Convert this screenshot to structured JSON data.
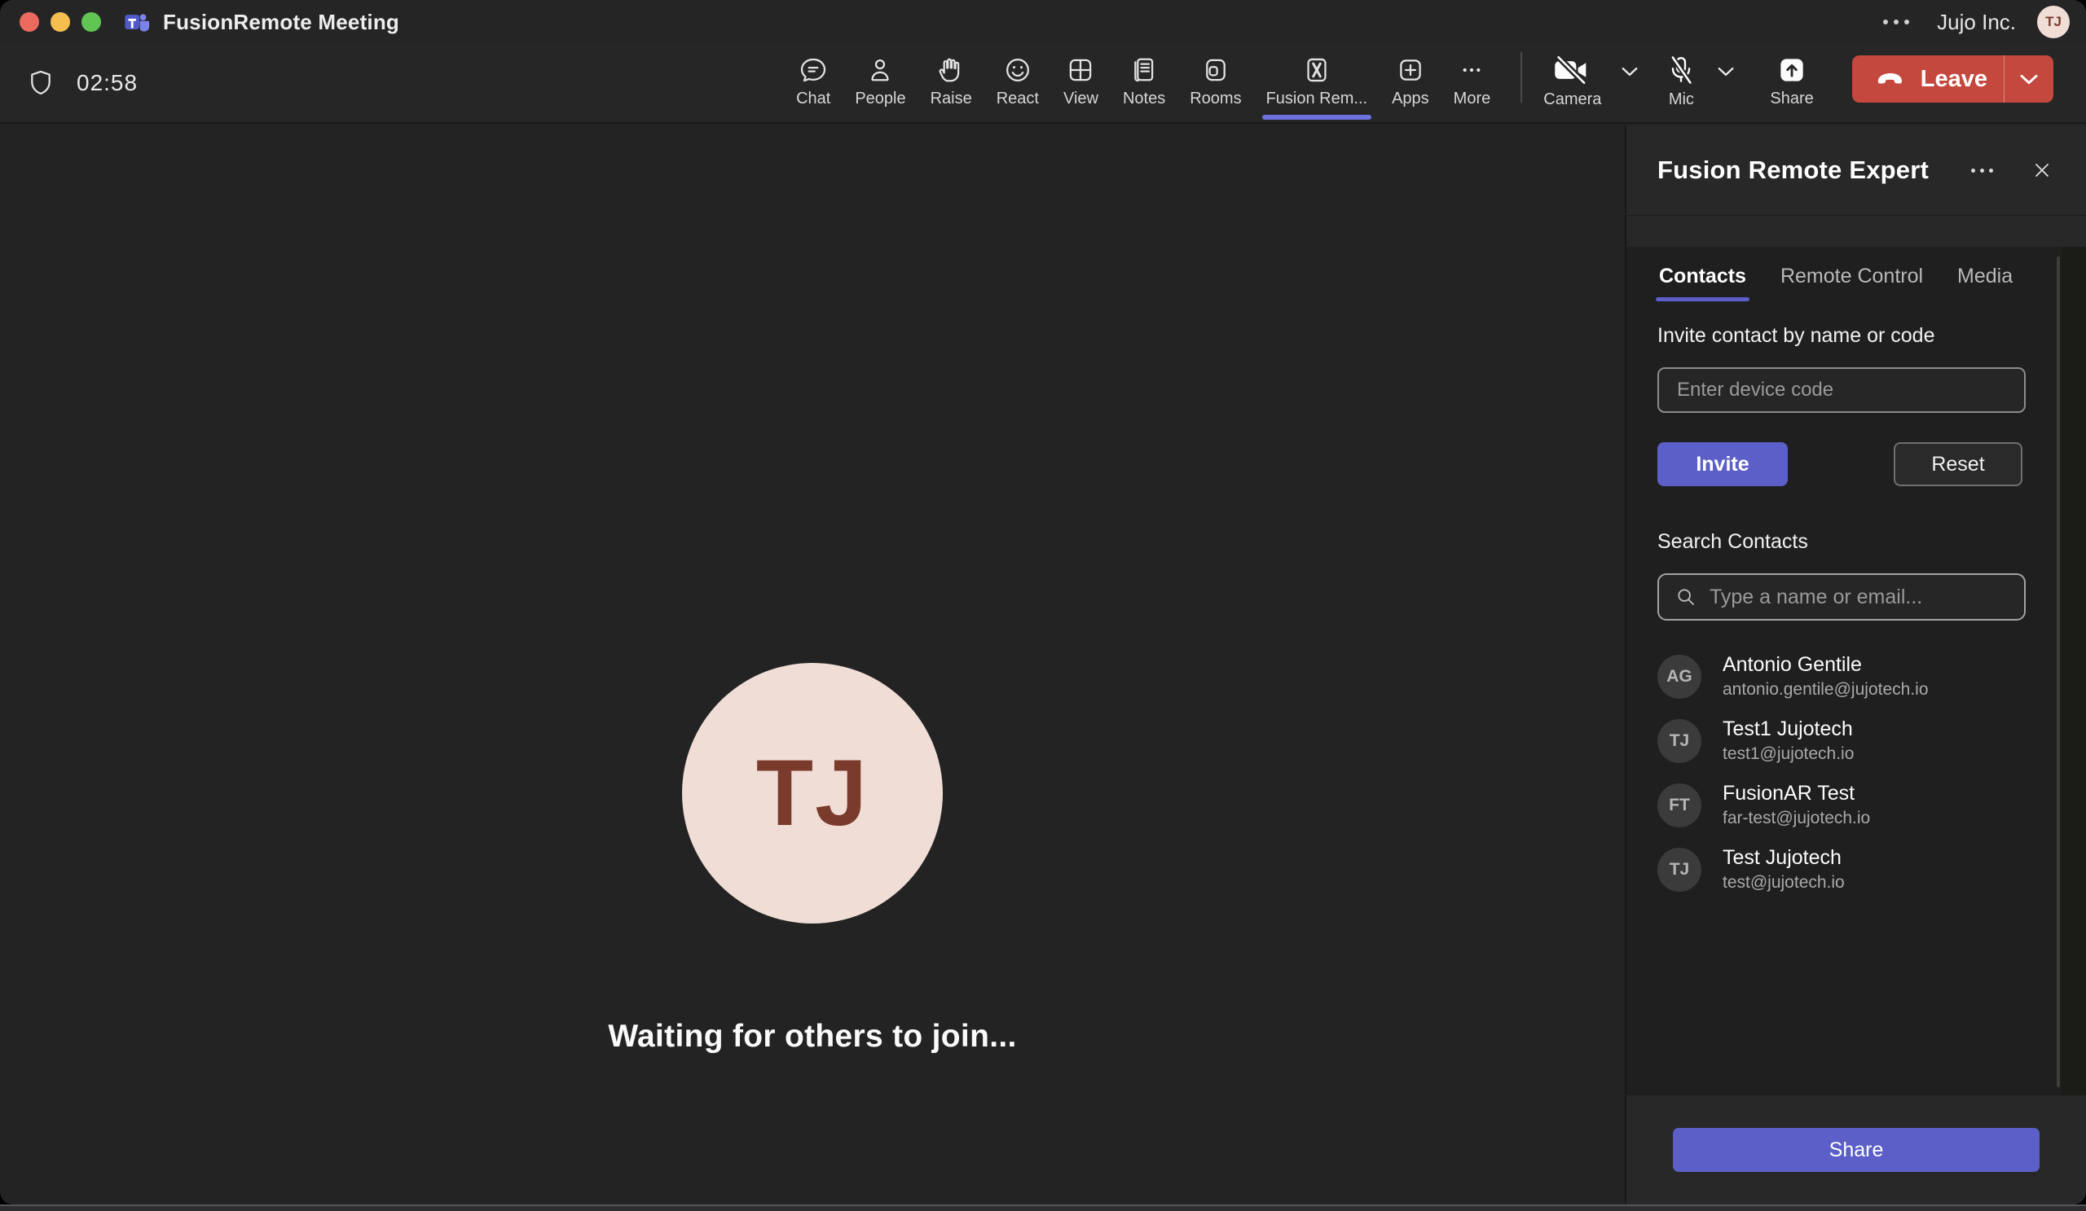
{
  "titlebar": {
    "app_title": "FusionRemote Meeting",
    "org_name": "Jujo Inc.",
    "avatar_initials": "TJ"
  },
  "toolbar": {
    "timer": "02:58",
    "items": [
      {
        "id": "chat",
        "label": "Chat"
      },
      {
        "id": "people",
        "label": "People"
      },
      {
        "id": "raise",
        "label": "Raise"
      },
      {
        "id": "react",
        "label": "React"
      },
      {
        "id": "view",
        "label": "View"
      },
      {
        "id": "notes",
        "label": "Notes"
      },
      {
        "id": "rooms",
        "label": "Rooms"
      },
      {
        "id": "fusion-remote",
        "label": "Fusion Rem...",
        "active": true
      },
      {
        "id": "apps",
        "label": "Apps"
      },
      {
        "id": "more",
        "label": "More"
      }
    ],
    "camera_label": "Camera",
    "mic_label": "Mic",
    "share_label": "Share",
    "leave_label": "Leave",
    "camera_muted": true,
    "mic_muted": true
  },
  "stage": {
    "avatar_initials": "TJ",
    "waiting_text": "Waiting for others to join..."
  },
  "panel": {
    "title": "Fusion Remote Expert",
    "tabs": [
      {
        "label": "Contacts",
        "active": true
      },
      {
        "label": "Remote Control",
        "active": false
      },
      {
        "label": "Media",
        "active": false
      }
    ],
    "invite_label": "Invite contact by name or code",
    "device_code_placeholder": "Enter device code",
    "device_code_value": "",
    "invite_button": "Invite",
    "reset_button": "Reset",
    "search_label": "Search Contacts",
    "search_placeholder": "Type a name or email...",
    "search_value": "",
    "contacts": [
      {
        "initials": "AG",
        "name": "Antonio Gentile",
        "email": "antonio.gentile@jujotech.io"
      },
      {
        "initials": "TJ",
        "name": "Test1 Jujotech",
        "email": "test1@jujotech.io"
      },
      {
        "initials": "FT",
        "name": "FusionAR Test",
        "email": "far-test@jujotech.io"
      },
      {
        "initials": "TJ",
        "name": "Test Jujotech",
        "email": "test@jujotech.io"
      }
    ],
    "share_button": "Share"
  },
  "colors": {
    "accent": "#5B5FC7",
    "accent-underline": "#6E72DE",
    "leave-red": "#C4483E",
    "avatar-bg": "#F0DED6",
    "avatar-fg": "#7A3B2C"
  }
}
